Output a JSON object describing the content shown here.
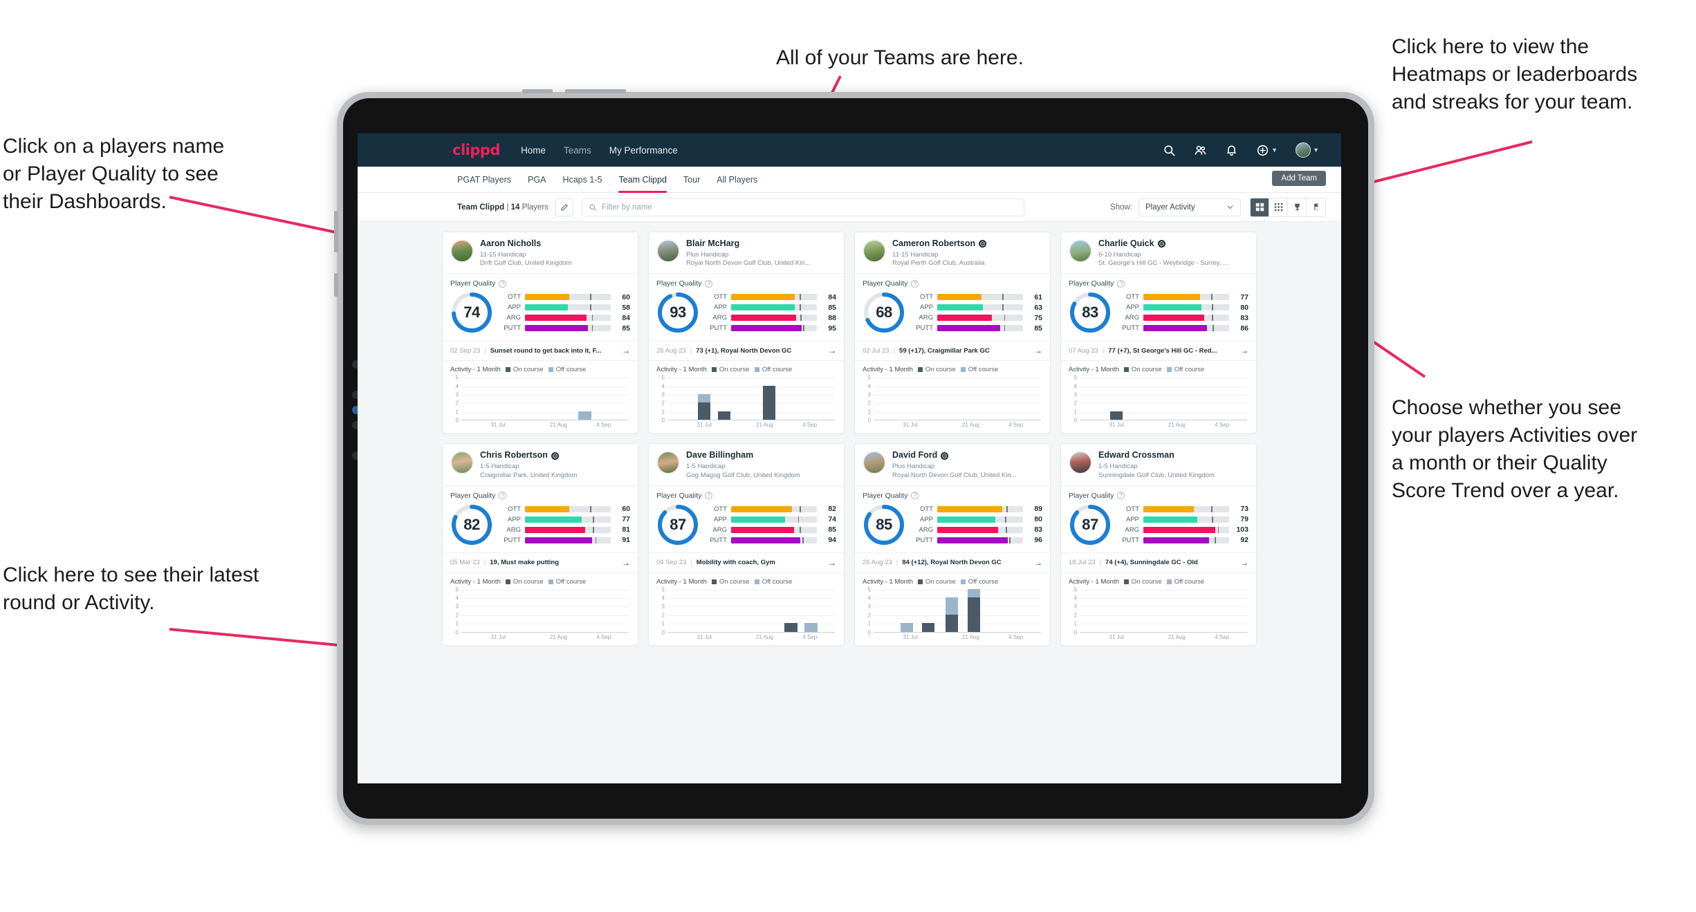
{
  "annotations": [
    {
      "id": "a-players",
      "text": "Click on a players name\nor Player Quality to see\ntheir Dashboards."
    },
    {
      "id": "a-teams",
      "text": "All of your Teams are here."
    },
    {
      "id": "a-heatmaps",
      "text": "Click here to view the\nHeatmaps or leaderboards\nand streaks for your team."
    },
    {
      "id": "a-choose",
      "text": "Choose whether you see\nyour players Activities over\na month or their Quality\nScore Trend over a year."
    },
    {
      "id": "a-latest",
      "text": "Click here to see their latest\nround or Activity."
    }
  ],
  "app": {
    "brand": "clippd",
    "nav": [
      {
        "label": "Home",
        "active": true
      },
      {
        "label": "Teams",
        "active": false
      },
      {
        "label": "My Performance",
        "active": true
      }
    ],
    "nav_icons": [
      "search-icon",
      "people-icon",
      "bell-icon",
      "plus-circle-icon",
      "avatar"
    ],
    "subtabs": [
      {
        "label": "PGAT Players",
        "active": false
      },
      {
        "label": "PGA",
        "active": false
      },
      {
        "label": "Hcaps 1-5",
        "active": false
      },
      {
        "label": "Team Clippd",
        "active": true
      },
      {
        "label": "Tour",
        "active": false
      },
      {
        "label": "All Players",
        "active": false
      }
    ],
    "add_team_label": "Add Team",
    "toolbar": {
      "team_name": "Team Clippd",
      "separator": "|",
      "player_count": "14",
      "players_word": "Players",
      "edit_icon": "pencil-icon",
      "search_placeholder": "Filter by name",
      "search_value": "",
      "show_label": "Show:",
      "show_value": "Player Activity",
      "view_buttons": [
        "grid-large-icon",
        "grid-small-icon",
        "trophy-icon",
        "flag-icon"
      ],
      "active_view": 0
    },
    "accent": "#ef1f5c",
    "navbg": "#16303f"
  },
  "card_labels": {
    "player_quality": "Player Quality",
    "activity": "Activity - 1 Month",
    "legend_on": "On course",
    "legend_off": "Off course",
    "metrics": [
      "OTT",
      "APP",
      "ARG",
      "PUTT"
    ],
    "metric_colors": [
      "#f7a700",
      "#2ed9ad",
      "#f4125f",
      "#a60cc4"
    ],
    "ring_color": "#1a7fd4",
    "y_ticks": [
      "5",
      "4",
      "3",
      "2",
      "1",
      "0"
    ],
    "x_ticks": [
      "31 Jul",
      "21 Aug",
      "4 Sep"
    ]
  },
  "players": [
    {
      "name": "Aaron Nicholls",
      "verified": false,
      "handicap": "11-15 Handicap",
      "club": "Drift Golf Club, United Kingdom",
      "avatar": "linear-gradient(170deg,#e8a37a 0%,#6e8f52 45%,#3d6b2e 100%)",
      "quality": 74,
      "metrics": [
        {
          "key": "OTT",
          "value": 60,
          "fill": 52,
          "tick": 76
        },
        {
          "key": "APP",
          "value": 58,
          "fill": 50,
          "tick": 76
        },
        {
          "key": "ARG",
          "value": 84,
          "fill": 72,
          "tick": 78
        },
        {
          "key": "PUTT",
          "value": 85,
          "fill": 73,
          "tick": 78
        }
      ],
      "last_round": {
        "date": "02 Sep 23",
        "text": "Sunset round to get back into it, F..."
      },
      "activity": [
        {
          "x": 0.7,
          "on": 0,
          "off": 1
        }
      ]
    },
    {
      "name": "Blair McHarg",
      "verified": false,
      "handicap": "Plus Handicap",
      "club": "Royal North Devon Golf Club, United Kin...",
      "avatar": "linear-gradient(170deg,#b8c5cf 0%,#7f8f7a 50%,#4e6040 100%)",
      "quality": 93,
      "metrics": [
        {
          "key": "OTT",
          "value": 84,
          "fill": 74,
          "tick": 80
        },
        {
          "key": "APP",
          "value": 85,
          "fill": 74,
          "tick": 80
        },
        {
          "key": "ARG",
          "value": 88,
          "fill": 76,
          "tick": 81
        },
        {
          "key": "PUTT",
          "value": 95,
          "fill": 82,
          "tick": 84
        }
      ],
      "last_round": {
        "date": "26 Aug 23",
        "text": "73 (+1), Royal North Devon GC"
      },
      "activity": [
        {
          "x": 0.18,
          "on": 2,
          "off": 1
        },
        {
          "x": 0.3,
          "on": 1,
          "off": 0
        },
        {
          "x": 0.57,
          "on": 4,
          "off": 0
        }
      ]
    },
    {
      "name": "Cameron Robertson",
      "verified": true,
      "handicap": "11-15 Handicap",
      "club": "Royal Perth Golf Club, Australia",
      "avatar": "linear-gradient(170deg,#b7cf96 0%,#7c9a5a 50%,#4f6b33 100%)",
      "quality": 68,
      "metrics": [
        {
          "key": "OTT",
          "value": 61,
          "fill": 52,
          "tick": 76
        },
        {
          "key": "APP",
          "value": 63,
          "fill": 53,
          "tick": 76
        },
        {
          "key": "ARG",
          "value": 75,
          "fill": 64,
          "tick": 78
        },
        {
          "key": "PUTT",
          "value": 85,
          "fill": 73,
          "tick": 78
        }
      ],
      "last_round": {
        "date": "02 Jul 23",
        "text": "59 (+17), Craigmillar Park GC"
      },
      "activity": []
    },
    {
      "name": "Charlie Quick",
      "verified": true,
      "handicap": "6-10 Handicap",
      "club": "St. George's Hill GC - Weybridge - Surrey, ...",
      "avatar": "linear-gradient(170deg,#9ec8e8 0%,#8fae79 55%,#547a3e 100%)",
      "quality": 83,
      "metrics": [
        {
          "key": "OTT",
          "value": 77,
          "fill": 66,
          "tick": 79
        },
        {
          "key": "APP",
          "value": 80,
          "fill": 68,
          "tick": 80
        },
        {
          "key": "ARG",
          "value": 83,
          "fill": 71,
          "tick": 80
        },
        {
          "key": "PUTT",
          "value": 86,
          "fill": 74,
          "tick": 81
        }
      ],
      "last_round": {
        "date": "07 Aug 23",
        "text": "77 (+7), St George's Hill GC - Red..."
      },
      "activity": [
        {
          "x": 0.18,
          "on": 1,
          "off": 0
        }
      ]
    },
    {
      "name": "Chris Robertson",
      "verified": true,
      "handicap": "1-5 Handicap",
      "club": "Craigmillar Park, United Kingdom",
      "avatar": "linear-gradient(170deg,#86a86a 0%,#d9b49a 45%,#6c8f52 100%)",
      "quality": 82,
      "metrics": [
        {
          "key": "OTT",
          "value": 60,
          "fill": 52,
          "tick": 76
        },
        {
          "key": "APP",
          "value": 77,
          "fill": 66,
          "tick": 79
        },
        {
          "key": "ARG",
          "value": 81,
          "fill": 70,
          "tick": 79
        },
        {
          "key": "PUTT",
          "value": 91,
          "fill": 78,
          "tick": 82
        }
      ],
      "last_round": {
        "date": "05 Mar 23",
        "text": "19, Must make putting"
      },
      "activity": []
    },
    {
      "name": "Dave Billingham",
      "verified": false,
      "handicap": "1-5 Handicap",
      "club": "Gog Magog Golf Club, United Kingdom",
      "avatar": "linear-gradient(170deg,#6f8f55 0%,#d7ab8c 48%,#55713f 100%)",
      "quality": 87,
      "metrics": [
        {
          "key": "OTT",
          "value": 82,
          "fill": 71,
          "tick": 80
        },
        {
          "key": "APP",
          "value": 74,
          "fill": 63,
          "tick": 78
        },
        {
          "key": "ARG",
          "value": 85,
          "fill": 73,
          "tick": 80
        },
        {
          "key": "PUTT",
          "value": 94,
          "fill": 81,
          "tick": 83
        }
      ],
      "last_round": {
        "date": "04 Sep 23",
        "text": "Mobility with coach, Gym"
      },
      "activity": [
        {
          "x": 0.7,
          "on": 1,
          "off": 0
        },
        {
          "x": 0.82,
          "on": 0,
          "off": 1
        }
      ]
    },
    {
      "name": "David Ford",
      "verified": true,
      "handicap": "Plus Handicap",
      "club": "Royal North Devon Golf Club, United Kin...",
      "avatar": "linear-gradient(170deg,#9dc0d8 0%,#b69a76 50%,#6a7f4e 100%)",
      "quality": 85,
      "metrics": [
        {
          "key": "OTT",
          "value": 89,
          "fill": 76,
          "tick": 81
        },
        {
          "key": "APP",
          "value": 80,
          "fill": 68,
          "tick": 79
        },
        {
          "key": "ARG",
          "value": 83,
          "fill": 71,
          "tick": 80
        },
        {
          "key": "PUTT",
          "value": 96,
          "fill": 82,
          "tick": 84
        }
      ],
      "last_round": {
        "date": "26 Aug 23",
        "text": "84 (+12), Royal North Devon GC"
      },
      "activity": [
        {
          "x": 0.16,
          "on": 0,
          "off": 1
        },
        {
          "x": 0.29,
          "on": 1,
          "off": 0
        },
        {
          "x": 0.43,
          "on": 2,
          "off": 2
        },
        {
          "x": 0.56,
          "on": 4,
          "off": 1
        }
      ]
    },
    {
      "name": "Edward Crossman",
      "verified": false,
      "handicap": "1-5 Handicap",
      "club": "Sunningdale Golf Club, United Kingdom",
      "avatar": "linear-gradient(170deg,#cfcfcf 0%,#b06058 45%,#3d3d44 100%)",
      "quality": 87,
      "metrics": [
        {
          "key": "OTT",
          "value": 73,
          "fill": 59,
          "tick": 79
        },
        {
          "key": "APP",
          "value": 79,
          "fill": 63,
          "tick": 80
        },
        {
          "key": "ARG",
          "value": 103,
          "fill": 84,
          "tick": 87
        },
        {
          "key": "PUTT",
          "value": 92,
          "fill": 77,
          "tick": 83
        }
      ],
      "last_round": {
        "date": "18 Jul 23",
        "text": "74 (+4), Sunningdale GC - Old"
      },
      "activity": []
    }
  ]
}
